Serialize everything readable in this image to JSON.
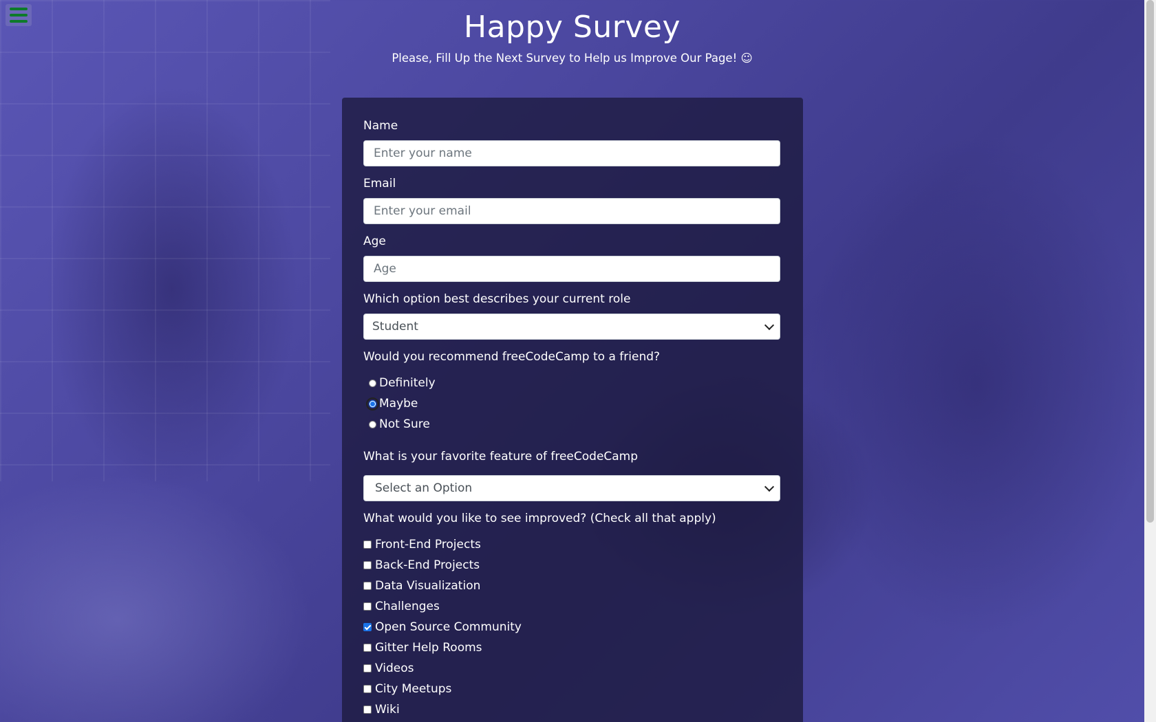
{
  "header": {
    "title": "Happy Survey",
    "subtitle": "Please, Fill Up the Next Survey to Help us Improve Our Page! ☺"
  },
  "form": {
    "name": {
      "label": "Name",
      "placeholder": "Enter your name",
      "value": ""
    },
    "email": {
      "label": "Email",
      "placeholder": "Enter your email",
      "value": ""
    },
    "age": {
      "label": "Age",
      "placeholder": "Age",
      "value": ""
    },
    "role": {
      "label": "Which option best describes your current role",
      "selected": "Student"
    },
    "recommend": {
      "label": "Would you recommend freeCodeCamp to a friend?",
      "options": [
        "Definitely",
        "Maybe",
        "Not Sure"
      ],
      "selected": "Maybe"
    },
    "favorite": {
      "label": "What is your favorite feature of freeCodeCamp",
      "selected": "Select an Option"
    },
    "improve": {
      "label": "What would you like to see improved? (Check all that apply)",
      "options": [
        {
          "label": "Front-End Projects",
          "checked": false
        },
        {
          "label": "Back-End Projects",
          "checked": false
        },
        {
          "label": "Data Visualization",
          "checked": false
        },
        {
          "label": "Challenges",
          "checked": false
        },
        {
          "label": "Open Source Community",
          "checked": true
        },
        {
          "label": "Gitter Help Rooms",
          "checked": false
        },
        {
          "label": "Videos",
          "checked": false
        },
        {
          "label": "City Meetups",
          "checked": false
        },
        {
          "label": "Wiki",
          "checked": false
        }
      ]
    }
  },
  "icons": {
    "menu": "hamburger-menu-icon"
  },
  "colors": {
    "menu_bars": "#0d7a2a",
    "accent": "#1a73e8"
  }
}
